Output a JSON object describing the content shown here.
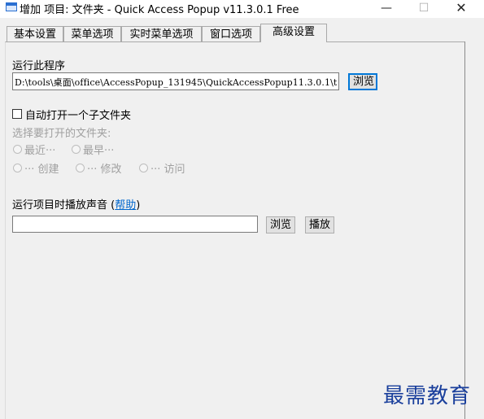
{
  "window": {
    "title": "增加 项目: 文件夹 - Quick Access Popup v11.3.0.1 Free",
    "minimize_icon": "minimize-icon",
    "maximize_icon": "maximize-icon",
    "close_icon": "close-icon"
  },
  "tabs": [
    {
      "label": "基本设置",
      "active": false
    },
    {
      "label": "菜单选项",
      "active": false
    },
    {
      "label": "实时菜单选项",
      "active": false
    },
    {
      "label": "窗口选项",
      "active": false
    },
    {
      "label": "高级设置",
      "active": true
    }
  ],
  "run_program": {
    "label": "运行此程序",
    "value": "D:\\tools\\桌面\\office\\AccessPopup_131945\\QuickAccessPopup11.3.0.1\\t",
    "browse_label": "浏览"
  },
  "open_subfolder": {
    "checkbox_label": "自动打开一个子文件夹",
    "checked": false,
    "select_label": "选择要打开的文件夹:",
    "options_row1": [
      "最近···",
      "最早···"
    ],
    "options_row2": [
      "··· 创建",
      "··· 修改",
      "··· 访问"
    ]
  },
  "sound": {
    "label_prefix": "运行项目时播放声音 (",
    "help_link": "帮助",
    "label_suffix": ")",
    "value": "",
    "browse_label": "浏览",
    "play_label": "播放"
  },
  "watermark": "最需教育",
  "colors": {
    "focus_border": "#0078d7",
    "link": "#0066cc",
    "watermark": "#1a3f9c"
  }
}
